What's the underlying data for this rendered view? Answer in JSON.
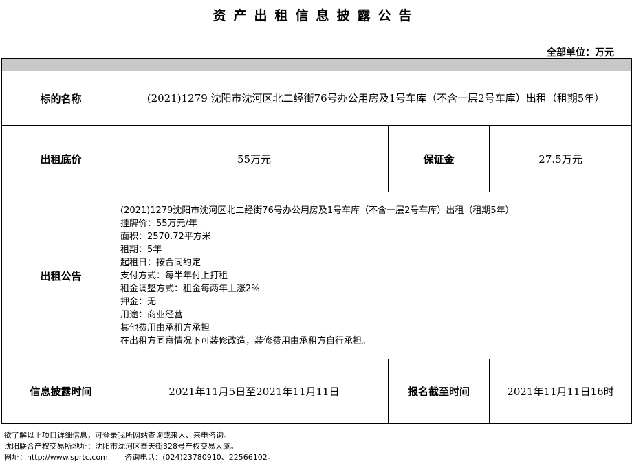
{
  "page": {
    "title": "资产出租信息披露公告",
    "unit_label": "全部单位：万元"
  },
  "table": {
    "name_label": "标的名称",
    "name_value": "(2021)1279 沈阳市沈河区北二经街76号办公用房及1号车库（不含一层2号车库）出租（租期5年）",
    "base_price_label": "出租底价",
    "base_price_value": "55万元",
    "deposit_label": "保证金",
    "deposit_value": "27.5万元",
    "notice_label": "出租公告",
    "notice_lines": [
      "(2021)1279沈阳市沈河区北二经街76号办公用房及1号车库（不含一层2号车库）出租（租期5年）",
      "挂牌价：55万元/年",
      "面积：2570.72平方米",
      "租期：5年",
      "起租日：按合同约定",
      "支付方式：每半年付上打租",
      "租金调整方式：租金每两年上涨2%",
      "押金：无",
      "用途：商业经营",
      "其他费用由承租方承担",
      "在出租方同意情况下可装修改造，装修费用由承租方自行承担。"
    ],
    "disclosure_label": "信息披露时间",
    "disclosure_value": "2021年11月5日至2021年11月11日",
    "deadline_label": "报名截至时间",
    "deadline_value": "2021年11月11日16时"
  },
  "footer": {
    "line1": "欲了解以上项目详细信息，可登录我所网站查询或来人、来电咨询。",
    "line2": "沈阳联合产权交易所地址：沈阳市沈河区奉天街328号产权交易大厦。",
    "line3": "网址：http://www.sprtc.com.      咨询电话：(024)23780910、22566102。"
  }
}
